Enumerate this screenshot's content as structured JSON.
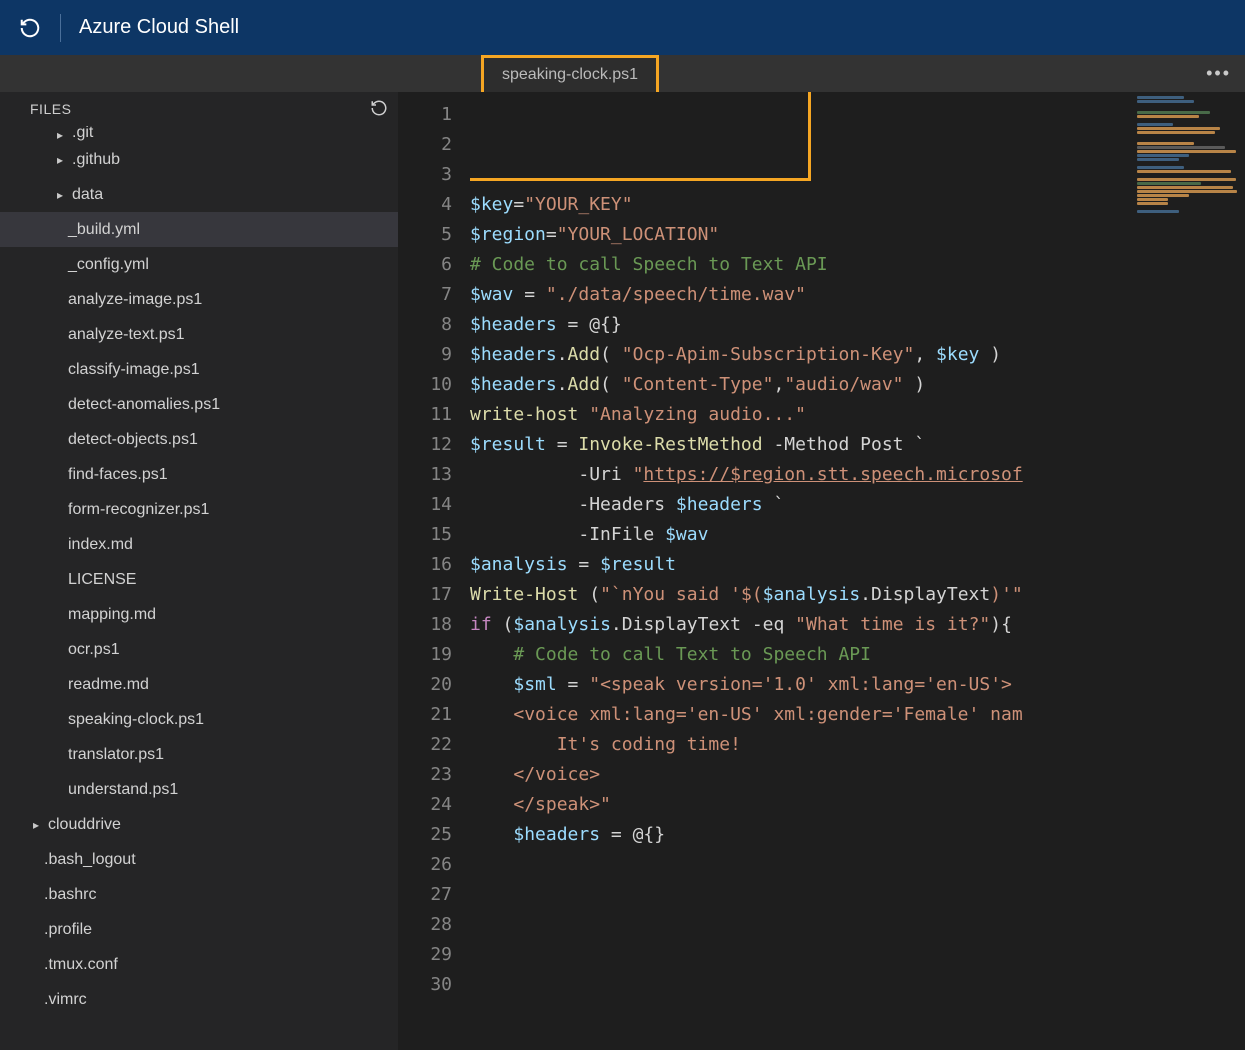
{
  "header": {
    "title": "Azure Cloud Shell"
  },
  "tab": {
    "filename": "speaking-clock.ps1"
  },
  "sidebar": {
    "title": "FILES",
    "tree": [
      {
        "label": ".git",
        "type": "folder",
        "depth": 2,
        "truncatedTop": true
      },
      {
        "label": ".github",
        "type": "folder",
        "depth": 2
      },
      {
        "label": "data",
        "type": "folder",
        "depth": 2
      },
      {
        "label": "_build.yml",
        "type": "file",
        "depth": 3,
        "selected": true
      },
      {
        "label": "_config.yml",
        "type": "file",
        "depth": 3
      },
      {
        "label": "analyze-image.ps1",
        "type": "file",
        "depth": 3
      },
      {
        "label": "analyze-text.ps1",
        "type": "file",
        "depth": 3
      },
      {
        "label": "classify-image.ps1",
        "type": "file",
        "depth": 3
      },
      {
        "label": "detect-anomalies.ps1",
        "type": "file",
        "depth": 3
      },
      {
        "label": "detect-objects.ps1",
        "type": "file",
        "depth": 3
      },
      {
        "label": "find-faces.ps1",
        "type": "file",
        "depth": 3
      },
      {
        "label": "form-recognizer.ps1",
        "type": "file",
        "depth": 3
      },
      {
        "label": "index.md",
        "type": "file",
        "depth": 3
      },
      {
        "label": "LICENSE",
        "type": "file",
        "depth": 3
      },
      {
        "label": "mapping.md",
        "type": "file",
        "depth": 3
      },
      {
        "label": "ocr.ps1",
        "type": "file",
        "depth": 3
      },
      {
        "label": "readme.md",
        "type": "file",
        "depth": 3
      },
      {
        "label": "speaking-clock.ps1",
        "type": "file",
        "depth": 3
      },
      {
        "label": "translator.ps1",
        "type": "file",
        "depth": 3
      },
      {
        "label": "understand.ps1",
        "type": "file",
        "depth": 3
      },
      {
        "label": "clouddrive",
        "type": "folder",
        "depth": 1
      },
      {
        "label": ".bash_logout",
        "type": "file",
        "depth": "file"
      },
      {
        "label": ".bashrc",
        "type": "file",
        "depth": "file"
      },
      {
        "label": ".profile",
        "type": "file",
        "depth": "file"
      },
      {
        "label": ".tmux.conf",
        "type": "file",
        "depth": "file"
      },
      {
        "label": ".vimrc",
        "type": "file",
        "depth": "file"
      }
    ]
  },
  "code_lines": [
    {
      "n": 1,
      "tokens": [
        [
          "var",
          "$key"
        ],
        [
          "op",
          "="
        ],
        [
          "str",
          "\"YOUR_KEY\""
        ]
      ]
    },
    {
      "n": 2,
      "tokens": [
        [
          "var",
          "$region"
        ],
        [
          "op",
          "="
        ],
        [
          "str",
          "\"YOUR_LOCATION\""
        ]
      ]
    },
    {
      "n": 3,
      "tokens": []
    },
    {
      "n": 4,
      "tokens": []
    },
    {
      "n": 5,
      "tokens": [
        [
          "cmt",
          "# Code to call Speech to Text API"
        ]
      ]
    },
    {
      "n": 6,
      "tokens": [
        [
          "var",
          "$wav"
        ],
        [
          "op",
          " = "
        ],
        [
          "str",
          "\"./data/speech/time.wav\""
        ]
      ]
    },
    {
      "n": 7,
      "tokens": []
    },
    {
      "n": 8,
      "tokens": [
        [
          "var",
          "$headers"
        ],
        [
          "op",
          " = "
        ],
        [
          "at",
          "@{}"
        ]
      ]
    },
    {
      "n": 9,
      "tokens": [
        [
          "var",
          "$headers"
        ],
        [
          "op",
          "."
        ],
        [
          "fn",
          "Add"
        ],
        [
          "op",
          "( "
        ],
        [
          "str",
          "\"Ocp-Apim-Subscription-Key\""
        ],
        [
          "op",
          ", "
        ],
        [
          "var",
          "$key"
        ],
        [
          "op",
          " )"
        ]
      ]
    },
    {
      "n": 10,
      "tokens": [
        [
          "var",
          "$headers"
        ],
        [
          "op",
          "."
        ],
        [
          "fn",
          "Add"
        ],
        [
          "op",
          "( "
        ],
        [
          "str",
          "\"Content-Type\""
        ],
        [
          "op",
          ","
        ],
        [
          "str",
          "\"audio/wav\""
        ],
        [
          "op",
          " )"
        ]
      ]
    },
    {
      "n": 11,
      "tokens": []
    },
    {
      "n": 12,
      "tokens": []
    },
    {
      "n": 13,
      "tokens": [
        [
          "cmd",
          "write-host"
        ],
        [
          "txt",
          " "
        ],
        [
          "str",
          "\"Analyzing audio...\""
        ]
      ]
    },
    {
      "n": 14,
      "tokens": [
        [
          "var",
          "$result"
        ],
        [
          "op",
          " = "
        ],
        [
          "cmd",
          "Invoke-RestMethod"
        ],
        [
          "txt",
          " -Method Post `"
        ]
      ]
    },
    {
      "n": 15,
      "tokens": [
        [
          "txt",
          "          -Uri "
        ],
        [
          "str",
          "\""
        ],
        [
          "url",
          "https://$region.stt.speech.microsof"
        ]
      ]
    },
    {
      "n": 16,
      "tokens": [
        [
          "txt",
          "          -Headers "
        ],
        [
          "var",
          "$headers"
        ],
        [
          "txt",
          " `"
        ]
      ]
    },
    {
      "n": 17,
      "tokens": [
        [
          "txt",
          "          -InFile "
        ],
        [
          "var",
          "$wav"
        ]
      ]
    },
    {
      "n": 18,
      "tokens": []
    },
    {
      "n": 19,
      "tokens": [
        [
          "var",
          "$analysis"
        ],
        [
          "op",
          " = "
        ],
        [
          "var",
          "$result"
        ]
      ]
    },
    {
      "n": 20,
      "tokens": [
        [
          "cmd",
          "Write-Host"
        ],
        [
          "txt",
          " ("
        ],
        [
          "str",
          "\"`nYou said '$("
        ],
        [
          "var",
          "$analysis"
        ],
        [
          "op",
          "."
        ],
        [
          "txt",
          "DisplayText"
        ],
        [
          "str",
          ")'\""
        ]
      ]
    },
    {
      "n": 21,
      "tokens": []
    },
    {
      "n": 22,
      "tokens": [
        [
          "kw",
          "if"
        ],
        [
          "txt",
          " ("
        ],
        [
          "var",
          "$analysis"
        ],
        [
          "op",
          "."
        ],
        [
          "txt",
          "DisplayText "
        ],
        [
          "op",
          "-eq"
        ],
        [
          "txt",
          " "
        ],
        [
          "str",
          "\"What time is it?\""
        ],
        [
          "txt",
          "){"
        ]
      ]
    },
    {
      "n": 23,
      "tokens": [
        [
          "txt",
          "    "
        ],
        [
          "cmt",
          "# Code to call Text to Speech API"
        ]
      ]
    },
    {
      "n": 24,
      "tokens": [
        [
          "txt",
          "    "
        ],
        [
          "var",
          "$sml"
        ],
        [
          "op",
          " = "
        ],
        [
          "str",
          "\"<speak version='1.0' xml:lang='en-US'>"
        ]
      ]
    },
    {
      "n": 25,
      "tokens": [
        [
          "txt",
          "    "
        ],
        [
          "str",
          "<voice xml:lang='en-US' xml:gender='Female' nam"
        ]
      ]
    },
    {
      "n": 26,
      "tokens": [
        [
          "txt",
          "        "
        ],
        [
          "str",
          "It's coding time!"
        ]
      ]
    },
    {
      "n": 27,
      "tokens": [
        [
          "txt",
          "    "
        ],
        [
          "str",
          "</voice>"
        ]
      ]
    },
    {
      "n": 28,
      "tokens": [
        [
          "txt",
          "    "
        ],
        [
          "str",
          "</speak>\""
        ]
      ]
    },
    {
      "n": 29,
      "tokens": []
    },
    {
      "n": 30,
      "tokens": [
        [
          "txt",
          "    "
        ],
        [
          "var",
          "$headers"
        ],
        [
          "op",
          " = "
        ],
        [
          "at",
          "@{}"
        ]
      ]
    }
  ]
}
